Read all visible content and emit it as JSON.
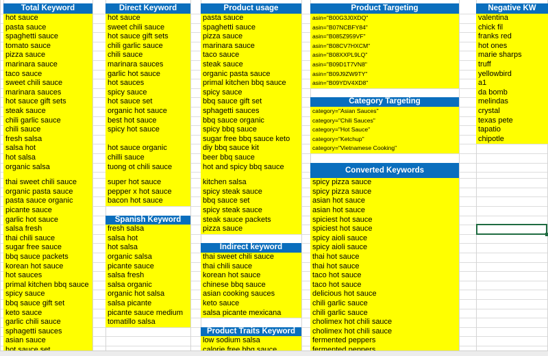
{
  "columns": [
    {
      "key": "total",
      "sections": [
        {
          "title": "Total Keyword",
          "items": [
            "hot sauce",
            "pasta sauce",
            "spaghetti sauce",
            "tomato sauce",
            "pizza sauce",
            "marinara sauce",
            "taco sauce",
            "sweet chili sauce",
            "marinara sauces",
            "hot sauce gift sets",
            "steak sauce",
            "chili garlic sauce",
            "chili sauce",
            "fresh salsa",
            "salsa hot",
            "hot salsa",
            "organic salsa",
            "",
            "thai sweet chili sauce",
            "organic pasta sauce",
            "pasta sauce organic",
            "picante sauce",
            "garlic hot sauce",
            "salsa fresh",
            "thai chili sauce",
            "sugar free sauce",
            "bbq sauce packets",
            "korean hot sauce",
            "hot sauces",
            "primal kitchen bbq sauce",
            "spicy sauce",
            "bbq sauce gift set",
            "keto sauce",
            "garlic chili sauce",
            "sphagetti sauces",
            "asian sauce",
            "hot sauce set"
          ]
        }
      ]
    },
    {
      "key": "direct",
      "sections": [
        {
          "title": "Direct Keyword",
          "items": [
            "hot sauce",
            "sweet chili sauce",
            "hot sauce gift sets",
            "chili garlic sauce",
            "chili sauce",
            "marinara sauces",
            "garlic hot sauce",
            "hot sauces",
            "spicy sauce",
            "hot sauce set",
            "organic hot sauce",
            "best hot sauce",
            "spicy hot sauce",
            "",
            "hot sauce organic",
            "chilli sauce",
            "tuong ot chili sauce",
            "",
            "super hot sauce",
            "pepper x hot sauce",
            "bacon hot sauce"
          ]
        },
        {
          "title": "Spanish Keyword",
          "items": [
            "fresh salsa",
            "salsa hot",
            "hot salsa",
            "organic salsa",
            "picante sauce",
            "salsa fresh",
            "salsa organic",
            "organic hot salsa",
            "salsa picante",
            "picante sauce medium",
            "tomatillo salsa"
          ]
        }
      ]
    },
    {
      "key": "usage",
      "sections": [
        {
          "title": "Product usage",
          "items": [
            "pasta sauce",
            "spaghetti sauce",
            "pizza sauce",
            "marinara sauce",
            "taco sauce",
            "steak sauce",
            "organic pasta sauce",
            "primal kitchen bbq sauce",
            "spicy sauce",
            "bbq sauce gift set",
            "sphagetti sauces",
            "bbq sauce organic",
            "spicy bbq sauce",
            "sugar free bbq sauce keto",
            "diy bbq sauce kit",
            "beer bbq sauce",
            "hot and spicy bbq sauce",
            "",
            "kitchen salsa",
            "spicy steak sauce",
            "bbq sauce set",
            "spicy steak sauce",
            "steak sauce packets",
            "pizza sauce"
          ]
        },
        {
          "title": "Indirect keyword",
          "items": [
            "thai sweet chili sauce",
            "thai chili sauce",
            "korean hot sauce",
            "chinese bbq sauce",
            "asian cooking sauces",
            "keto sauce",
            "salsa picante mexicana"
          ]
        },
        {
          "title": "Product Traits Keyword",
          "items": [
            "low sodium salsa",
            "calorie free bbq sauce"
          ]
        }
      ]
    },
    {
      "key": "targeting",
      "sections": [
        {
          "title": "Product Targeting",
          "small": true,
          "items": [
            "asin=\"B00G3J0XDQ\"",
            "asin=\"B07NCBFY84\"",
            "asin=\"B085Z959VF\"",
            "asin=\"B08CV7HXCM\"",
            "asin=\"B08XXPL9LQ\"",
            "asin=\"B09D1T7VN8\"",
            "asin=\"B09J9ZW9TY\"",
            "asin=\"B09YDV4XD8\""
          ]
        },
        {
          "title": "Category Targeting",
          "small": true,
          "items": [
            "category=\"Asian Sauces\"",
            "category=\"Chili Sauces\"",
            "category=\"Hot Sauce\"",
            "category=\"Ketchup\"",
            "category=\"Vietnamese Cooking\""
          ]
        },
        {
          "title": "Converted Keywords",
          "items": [
            "spicy pizza sauce",
            "spicy pizza sauce",
            "asian hot sauce",
            "asian hot sauce",
            "spiciest hot sauce",
            "spiciest hot sauce",
            "spicy aioli sauce",
            "spicy aioli sauce",
            "thai hot sauce",
            "thai hot sauce",
            "taco hot sauce",
            "taco hot sauce",
            "delicious hot sauce",
            "chili garlic sauce",
            "chili garlic sauce",
            "cholimex hot chili sauce",
            "cholimex hot chili sauce",
            "fermented peppers",
            "fermented peppers"
          ]
        }
      ]
    },
    {
      "key": "negative",
      "sections": [
        {
          "title": "Negative KW",
          "items": [
            "valentina",
            "chick fil",
            "franks red",
            "hot ones",
            "marie sharps",
            "truff",
            "yellowbird",
            "a1",
            "da bomb",
            "melindas",
            "crystal",
            "texas pete",
            "tapatio",
            "chipotle"
          ]
        }
      ]
    }
  ],
  "colors": {
    "header": "#0a6ebd",
    "highlight": "#ffff00",
    "selection": "#1e6b40"
  }
}
